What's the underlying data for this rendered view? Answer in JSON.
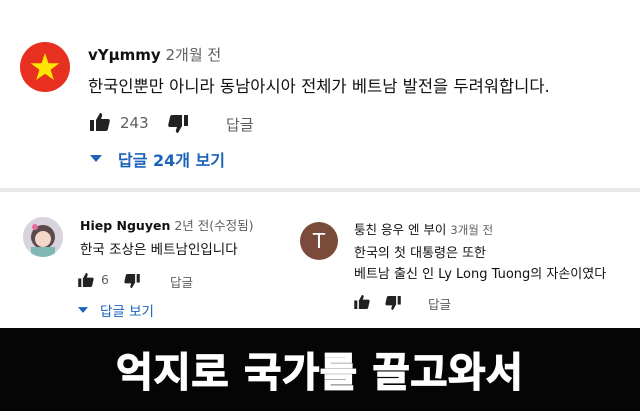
{
  "top_comment": {
    "author": "vYµmmy",
    "date": "2개월 전",
    "text": "한국인뿐만 아니라 동남아시아 전체가 베트남 발전을 두려워합니다.",
    "likes": "243",
    "reply_label": "답글",
    "replies_toggle": "답글 24개 보기"
  },
  "left_comment": {
    "author": "Hiep Nguyen",
    "date": "2년 전(수정됨)",
    "text": "한국 조상은 베트남인입니다",
    "likes": "6",
    "reply_label": "답글",
    "replies_toggle": "답글 보기"
  },
  "right_comment": {
    "avatar_letter": "T",
    "author": "퉁친 응우 엔 부이",
    "date": "3개월 전",
    "text_line1": "한국의 첫 대통령은 또한",
    "text_line2": "베트남 출신 인 Ly Long Tuong의 자손이였다",
    "reply_label": "답글"
  },
  "caption": "억지로 국가를 끌고와서",
  "colors": {
    "link_blue": "#1c62b9",
    "flag_red": "#e7301f",
    "flag_star": "#ffe600",
    "banner": "#050505"
  }
}
